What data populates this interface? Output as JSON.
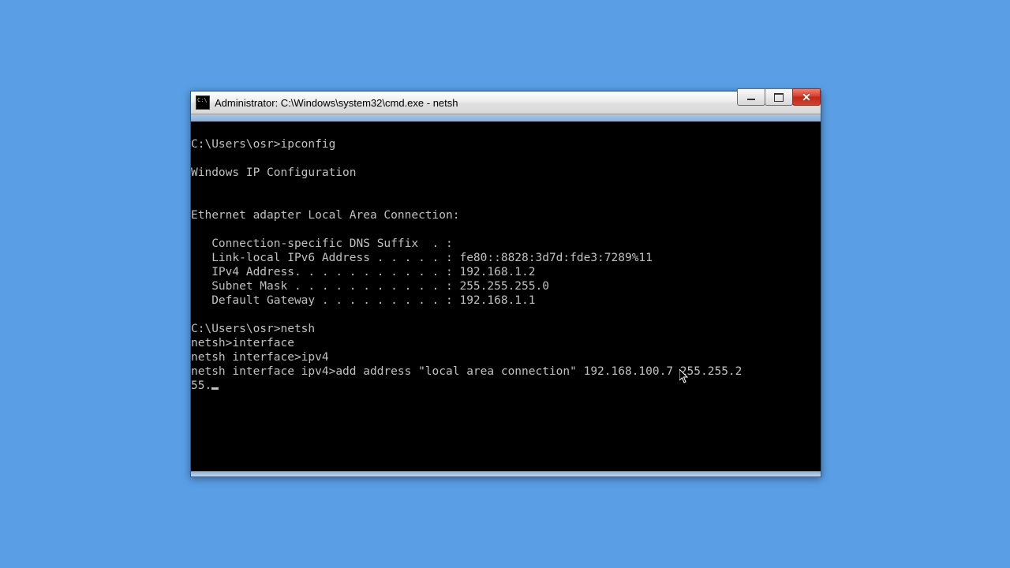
{
  "window": {
    "title": "Administrator: C:\\Windows\\system32\\cmd.exe - netsh"
  },
  "terminal": {
    "lines": [
      "",
      "C:\\Users\\osr>ipconfig",
      "",
      "Windows IP Configuration",
      "",
      "",
      "Ethernet adapter Local Area Connection:",
      "",
      "   Connection-specific DNS Suffix  . :",
      "   Link-local IPv6 Address . . . . . : fe80::8828:3d7d:fde3:7289%11",
      "   IPv4 Address. . . . . . . . . . . : 192.168.1.2",
      "   Subnet Mask . . . . . . . . . . . : 255.255.255.0",
      "   Default Gateway . . . . . . . . . : 192.168.1.1",
      "",
      "C:\\Users\\osr>netsh",
      "netsh>interface",
      "netsh interface>ipv4",
      "netsh interface ipv4>add address \"local area connection\" 192.168.100.7 255.255.2",
      "55."
    ]
  }
}
